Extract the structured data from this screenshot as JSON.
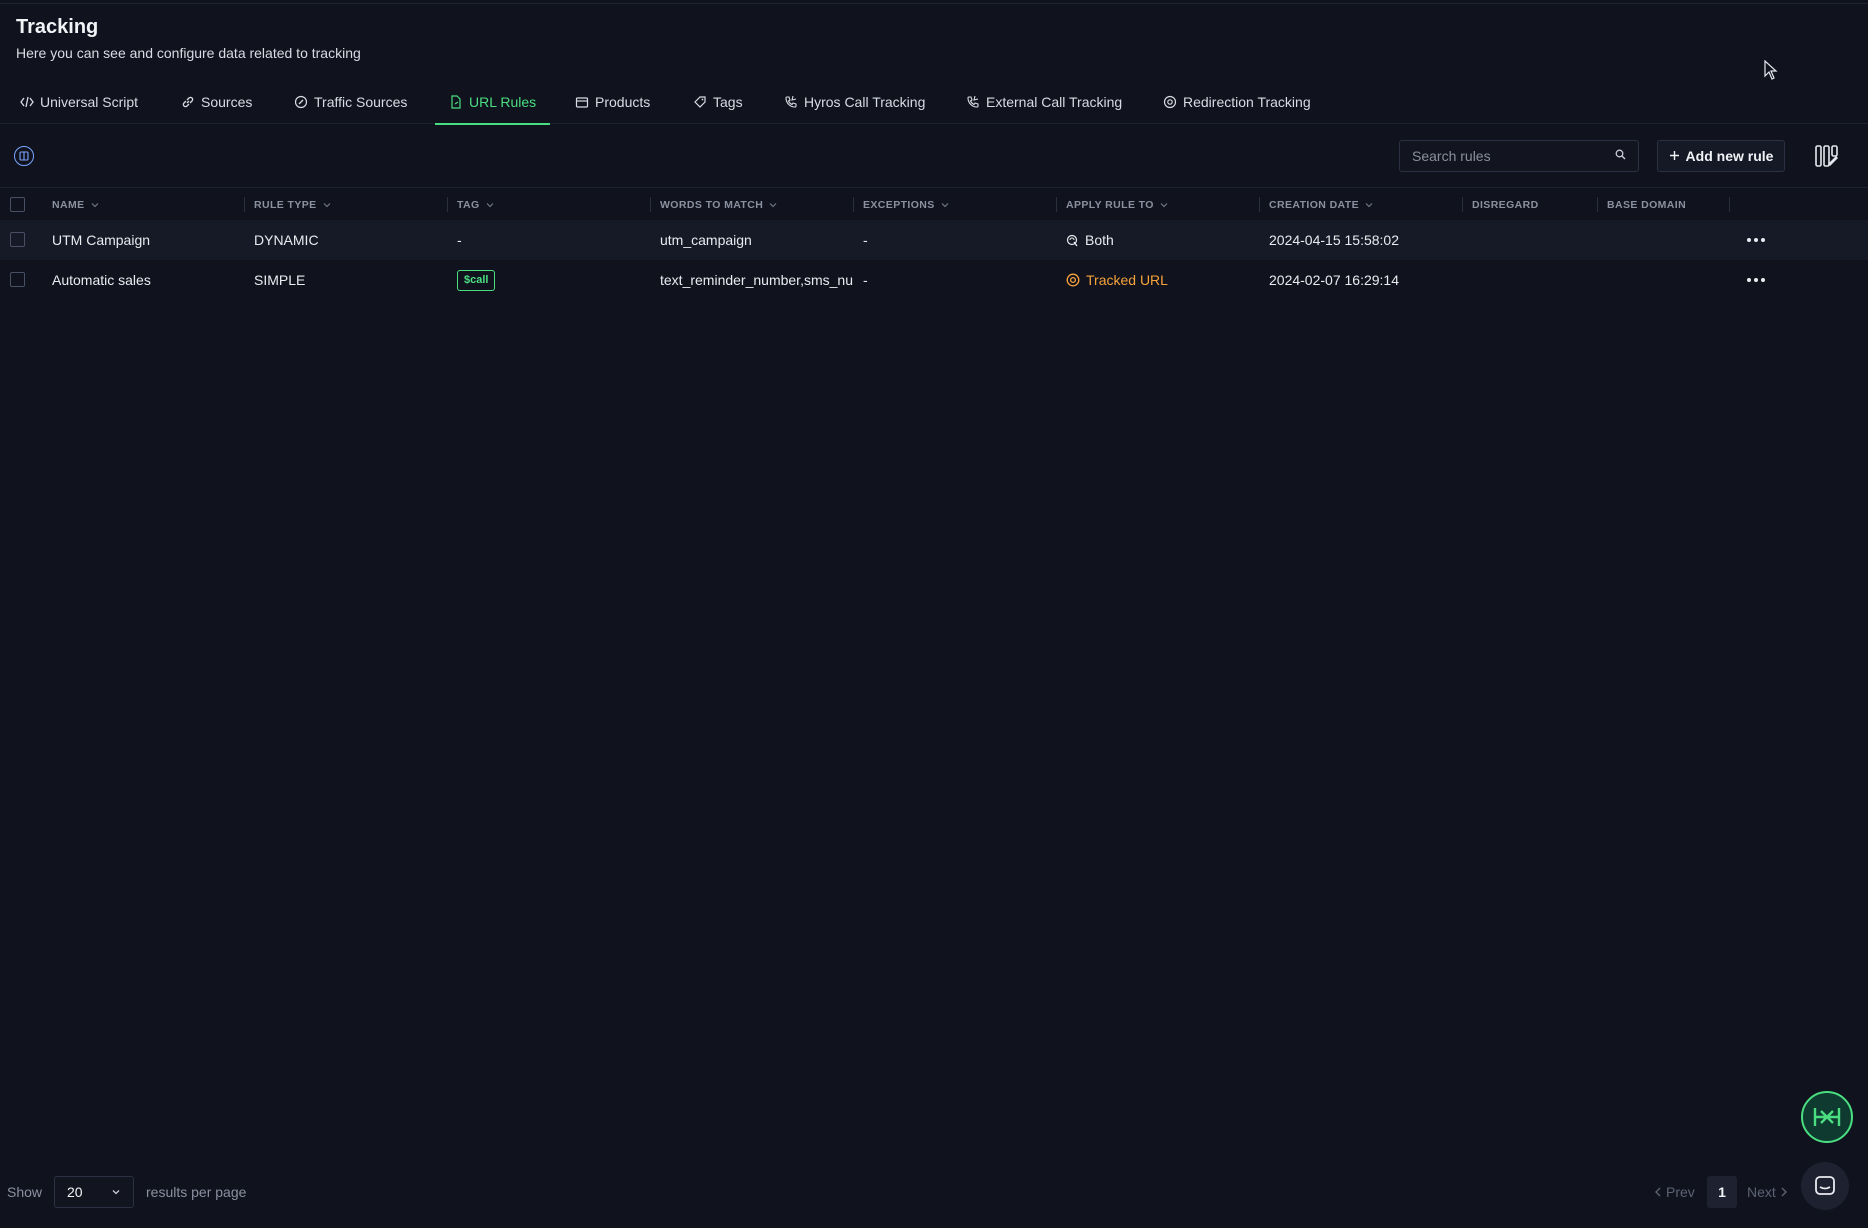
{
  "header": {
    "title": "Tracking",
    "subtitle": "Here you can see and configure data related to tracking"
  },
  "tabs": [
    {
      "label": "Universal Script",
      "icon": "code-icon",
      "active": false
    },
    {
      "label": "Sources",
      "icon": "link-icon",
      "active": false
    },
    {
      "label": "Traffic Sources",
      "icon": "edit-icon",
      "active": false
    },
    {
      "label": "URL Rules",
      "icon": "file-link-icon",
      "active": true
    },
    {
      "label": "Products",
      "icon": "box-icon",
      "active": false
    },
    {
      "label": "Tags",
      "icon": "tag-icon",
      "active": false
    },
    {
      "label": "Hyros Call Tracking",
      "icon": "phone-incoming-icon",
      "active": false
    },
    {
      "label": "External Call Tracking",
      "icon": "phone-incoming-icon",
      "active": false
    },
    {
      "label": "Redirection Tracking",
      "icon": "target-icon",
      "active": false
    }
  ],
  "toolbar": {
    "search_placeholder": "Search rules",
    "add_label": "Add new rule"
  },
  "table": {
    "columns": [
      "NAME",
      "RULE TYPE",
      "TAG",
      "WORDS TO MATCH",
      "EXCEPTIONS",
      "APPLY RULE TO",
      "CREATION DATE",
      "DISREGARD",
      "BASE DOMAIN"
    ],
    "rows": [
      {
        "name": "UTM Campaign",
        "rule_type": "DYNAMIC",
        "tag": "-",
        "words": "utm_campaign",
        "exceptions": "-",
        "apply": "Both",
        "date": "2024-04-15 15:58:02"
      },
      {
        "name": "Automatic sales",
        "rule_type": "SIMPLE",
        "tag": "$call",
        "words": "text_reminder_number,sms_nu",
        "exceptions": "-",
        "apply": "Tracked URL",
        "date": "2024-02-07 16:29:14"
      }
    ]
  },
  "footer": {
    "show_label": "Show",
    "page_size": "20",
    "results_label": "results per page",
    "prev_label": "Prev",
    "current_page": "1",
    "next_label": "Next"
  },
  "colors": {
    "accent": "#4ade80",
    "background": "#10131e",
    "tracked_url": "#f7a23b"
  }
}
